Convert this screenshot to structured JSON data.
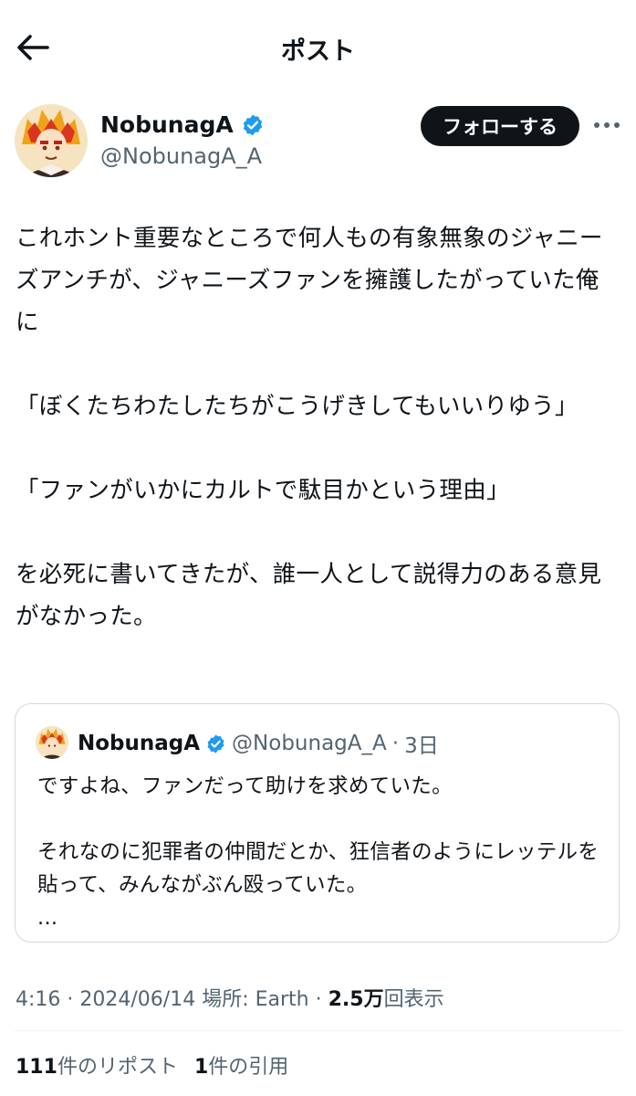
{
  "header": {
    "title": "ポスト"
  },
  "author": {
    "display_name": "NobunagA",
    "handle": "@NobunagA_A",
    "follow_label": "フォローする"
  },
  "tweet": {
    "text": "これホント重要なところで何人もの有象無象のジャニーズアンチが、ジャニーズファンを擁護したがっていた俺に\n\n「ぼくたちわたしたちがこうげきしてもいいりゆう」\n\n「ファンがいかにカルトで駄目かという理由」\n\nを必死に書いてきたが、誰一人として説得力のある意見がなかった。"
  },
  "quote": {
    "display_name": "NobunagA",
    "handle": "@NobunagA_A",
    "separator": "·",
    "time": "3日",
    "text": "ですよね、ファンだって助けを求めていた。\n\nそれなのに犯罪者の仲間だとか、狂信者のようにレッテルを貼って、みんながぶん殴っていた。\n..."
  },
  "meta": {
    "time": "4:16",
    "sep1": " · ",
    "date": "2024/06/14",
    "location": " 場所: Earth",
    "sep2": " · ",
    "views_count": "2.5万",
    "views_label": "回表示"
  },
  "stats": {
    "reposts_count": "111",
    "reposts_label": "件のリポスト",
    "quotes_count": "1",
    "quotes_label": "件の引用"
  },
  "colors": {
    "text": "#0f1419",
    "secondary": "#536471",
    "verified": "#1d9bf0",
    "border": "#cfd9de"
  },
  "icons": [
    "back-arrow-icon",
    "verified-badge-icon",
    "more-dots-icon"
  ]
}
